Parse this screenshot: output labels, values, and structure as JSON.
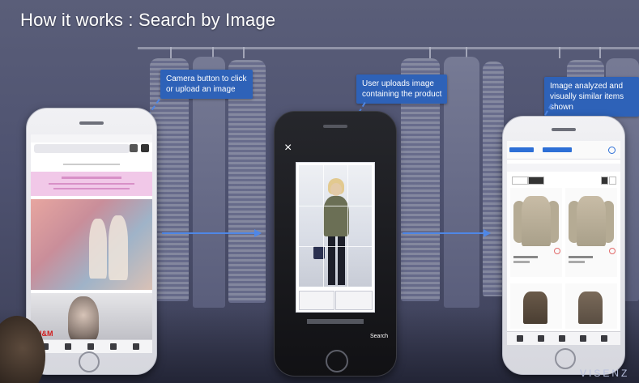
{
  "slide": {
    "title": "How it works : Search by Image",
    "brand": "VISENZ"
  },
  "callouts": [
    {
      "lines": [
        "Camera button to click",
        "or upload an image"
      ]
    },
    {
      "lines": [
        "User uploads image",
        "containing the product"
      ]
    },
    {
      "lines": [
        "Image analyzed and",
        "visually similar items shown"
      ]
    }
  ],
  "phone2": {
    "close_glyph": "×",
    "search_label": "Search"
  },
  "phone1": {
    "logo": "H&M"
  },
  "colors": {
    "callout_bg": "#2e62b8",
    "arrow": "#4f87e6",
    "title": "#ffffff"
  }
}
